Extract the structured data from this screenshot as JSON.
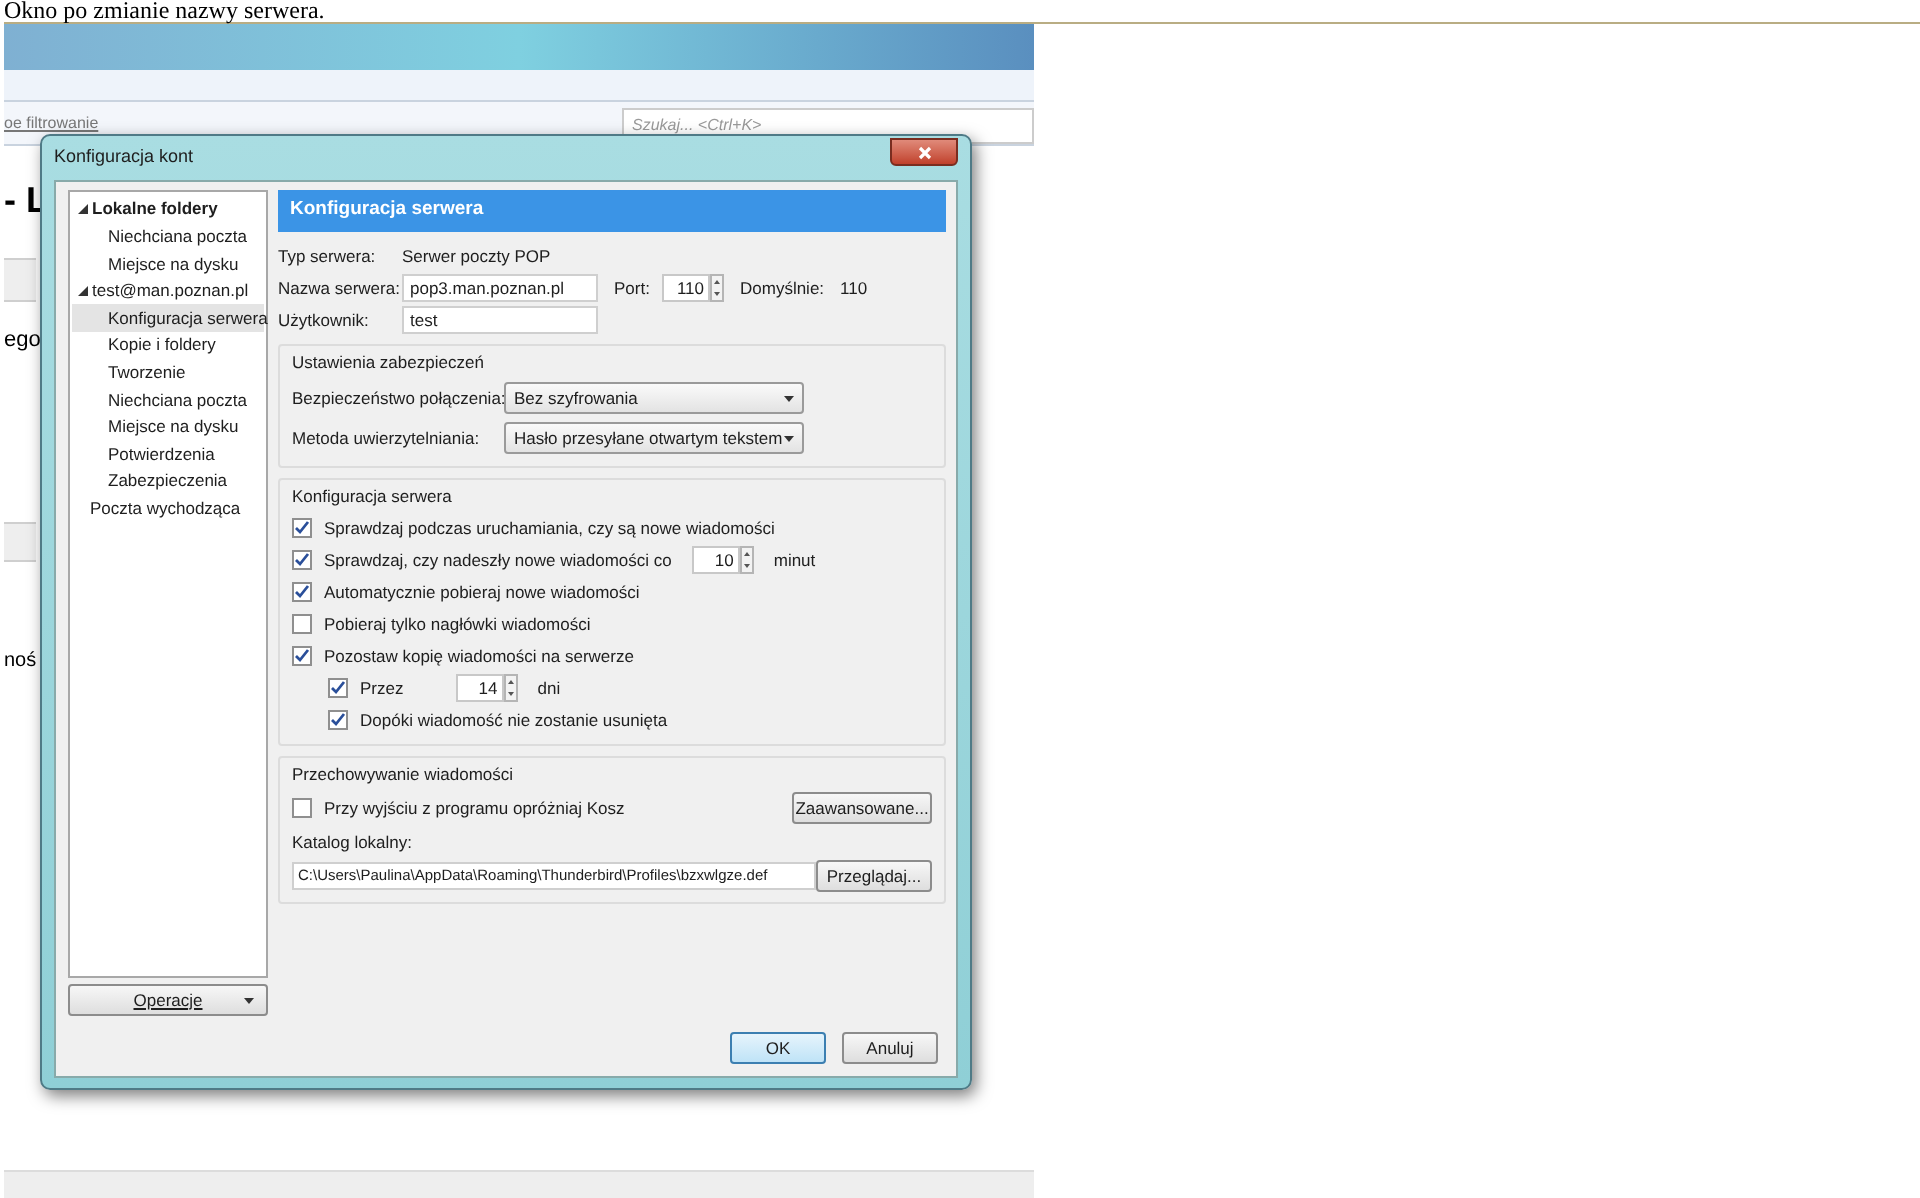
{
  "caption": "Okno po zmianie nazwy serwera.",
  "background_app": {
    "filter_label": "oe filtrowanie",
    "search_placeholder": "Szukaj... <Ctrl+K>",
    "heading_fragment": "- L",
    "side_texts": [
      "ego",
      "noś"
    ]
  },
  "dialog": {
    "title": "Konfiguracja kont",
    "tree": [
      {
        "label": "Lokalne foldery",
        "expanded": true,
        "default": true,
        "selected": false,
        "children": [
          {
            "label": "Niechciana poczta",
            "selected": false
          },
          {
            "label": "Miejsce na dysku",
            "selected": false
          }
        ]
      },
      {
        "label": "test@man.poznan.pl",
        "expanded": true,
        "default": false,
        "selected": false,
        "children": [
          {
            "label": "Konfiguracja serwera",
            "selected": true
          },
          {
            "label": "Kopie i foldery",
            "selected": false
          },
          {
            "label": "Tworzenie",
            "selected": false
          },
          {
            "label": "Niechciana poczta",
            "selected": false
          },
          {
            "label": "Miejsce na dysku",
            "selected": false
          },
          {
            "label": "Potwierdzenia",
            "selected": false
          },
          {
            "label": "Zabezpieczenia",
            "selected": false
          }
        ]
      },
      {
        "label": "Poczta wychodząca",
        "default": false,
        "selected": false
      }
    ],
    "operations_button": "Operacje",
    "panel_title": "Konfiguracja serwera",
    "server_type": {
      "label": "Typ serwera:",
      "value": "Serwer poczty POP"
    },
    "server_name": {
      "label": "Nazwa serwera:",
      "value": "pop3.man.poznan.pl"
    },
    "port": {
      "label": "Port:",
      "value": "110",
      "default_label": "Domyślnie:",
      "default_value": "110"
    },
    "user": {
      "label": "Użytkownik:",
      "value": "test"
    },
    "security": {
      "title": "Ustawienia zabezpieczeń",
      "rows": [
        {
          "label": "Bezpieczeństwo połączenia:",
          "value": "Bez szyfrowania"
        },
        {
          "label": "Metoda uwierzytelniania:",
          "value": "Hasło przesyłane otwartym tekstem"
        }
      ]
    },
    "server_settings": {
      "title": "Konfiguracja serwera",
      "options": [
        {
          "kind": "checkbox",
          "label": "Sprawdzaj podczas uruchamiania, czy są nowe wiadomości",
          "checked": true
        },
        {
          "kind": "number",
          "label": "Sprawdzaj, czy nadeszły nowe wiadomości co",
          "checked": true,
          "value": "10",
          "unit": "minut"
        },
        {
          "kind": "checkbox",
          "label": "Automatycznie pobieraj nowe wiadomości",
          "checked": true
        },
        {
          "kind": "checkbox",
          "label": "Pobieraj tylko nagłówki wiadomości",
          "checked": false
        },
        {
          "kind": "checkbox",
          "label": "Pozostaw kopię wiadomości na serwerze",
          "checked": true,
          "children": [
            {
              "kind": "number",
              "label": "Przez",
              "checked": true,
              "value": "14",
              "unit": "dni"
            },
            {
              "kind": "checkbox",
              "label": "Dopóki wiadomość nie zostanie usunięta",
              "checked": true
            }
          ]
        }
      ]
    },
    "storage": {
      "title": "Przechowywanie wiadomości",
      "empty_trash": {
        "label": "Przy wyjściu z programu opróżniaj Kosz",
        "checked": false
      },
      "advanced_button": "Zaawansowane...",
      "local_dir_label": "Katalog lokalny:",
      "local_dir_value": "C:\\Users\\Paulina\\AppData\\Roaming\\Thunderbird\\Profiles\\bzxwlgze.def",
      "browse_button": "Przeglądaj..."
    },
    "buttons": [
      {
        "label": "OK",
        "kind": "default"
      },
      {
        "label": "Anuluj",
        "kind": "normal"
      }
    ]
  }
}
